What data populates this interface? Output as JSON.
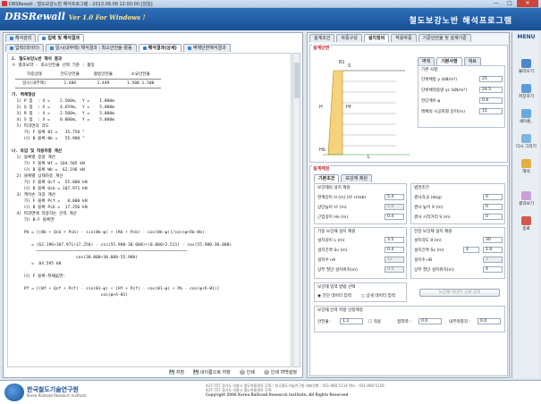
{
  "window": {
    "title": "DBSRewall : 철도보강노반 해석프로그램 - 2013.08.08 12:00:00 [임일]",
    "min": "—",
    "max": "□",
    "close": "✕"
  },
  "header": {
    "logo": "DBSRewall",
    "version": "Ver 1.0 For Windows !",
    "title": "철도보강노반 해석프로그램"
  },
  "left_tabs": [
    "해석관리",
    "입력 및 해석결과"
  ],
  "sub_tabs": [
    "입력(데이터)",
    "일시(내부랙) 해석결과 : 최소안전율-활동",
    "해석결과(상세)",
    "벽체단면해석결과"
  ],
  "doc": {
    "h1": "2. 철도보강노반 해석 결과",
    "summary": "※ 결과요약 - 최소안전율 선택 기준 : 활동",
    "table": {
      "headers": [
        "하중상태",
        "전도안전율",
        "활동안전율",
        "소요안전율"
      ],
      "rows": [
        [
          "일시(내부랙)",
          "1.486",
          "1.449",
          "1.500  1.500"
        ]
      ]
    },
    "lines": [
      "가. 벽체형상",
      "  1) P 점  : X =    2.500m,  Y =    1.800m",
      "  2) Q 점  : X =    4.659m,  Y =    5.000m",
      "  3) R 점  : X =    2.500m,  Y =    5.000m",
      "  4) S 점  : X =    0.000m,  Y =    5.000m",
      "  5) 파괴면의 각도",
      "     가) F 블록 θ1 =   35.750 °",
      "     나) B 블록 θb =   55.980 °",
      "",
      "나. 토압 및 작용하중 계산",
      "  1) 블록별 중량 계산",
      "     가) F 블록 Wf = 104.505 kN",
      "     나) B 블록 Wb =  62.196 kN",
      "  2) 블록별 상재하중 계산",
      "     가) F 블록 Qcf =  55.000 kN",
      "     나) B 블록 Qcb = 107.971 kN",
      "  3) 케이슨 하중 계산",
      "     가) F 블록 Pcf =   0.000 kN",
      "     나) B 블록 Pcb =  17.256 kN",
      "  4) 파괴면에 작용하는 인력 계산",
      "     가) B-F 블록면",
      "",
      "     Pb = [(Wb + Qcb + Pcb) · sin(θb-φ) + (Rb + Pcb) · cos(θb-φ)]/cos(φ+δb-θb)",
      "",
      "        = (62.196+107.971+17.256) · sin(55.980-30.000)+(0.000+2.511) · cos(55.980-30.000)",
      "          ─────────────────────────────────────────────────────────────",
      "                          cos(30.000+30.000-55.980)",
      "        =  84.595 kN",
      "",
      "     나) F 블록-뒤채움면:",
      "",
      "     Pf = [(Wf + Qcf + Pcf) · sin(θ1-φ) + (Hf + Pcf) · cos(θ1-φ) + Pb · cos(φ+δ-θ1)]",
      "                                    cos(φ+δ-θ1)"
    ]
  },
  "bottom_tools": [
    "저장",
    "내이름으로 저장",
    "인쇄",
    "인쇄 여백설정"
  ],
  "right_tabs": [
    "설계조건",
    "자중구성",
    "설치정의",
    "작용하중",
    "기준안전율 및 설계기준"
  ],
  "section": {
    "title": "설계단면",
    "tabs": [
      "벽체",
      "기본사항",
      "재료"
    ],
    "group": "기본 사항",
    "fields": [
      {
        "label": "단위체중 γ (kN/m³)",
        "value": "25"
      },
      {
        "label": "단위체적중량 γc (kN/m³)",
        "value": "24.5"
      },
      {
        "label": "전단계수 φ",
        "value": "0.6"
      },
      {
        "label": "벽체의 시공마찰 길이(m)",
        "value": "15"
      }
    ],
    "dims": [
      "B1",
      "S",
      "H",
      "Hf",
      "Hb",
      "L"
    ]
  },
  "reinf": {
    "title": "설계제원",
    "tabs": [
      "기본조건",
      "보강재 제원"
    ],
    "g1": {
      "title": "보강재의 설치 제원",
      "fields": [
        {
          "label": "연계길이 H (m) (H'+Heb)",
          "value": "5.4"
        },
        {
          "label": "상단높이 H' (m)",
          "value": "5.0"
        },
        {
          "label": "근입깊이 He (m)",
          "value": "0.4"
        }
      ]
    },
    "g2": {
      "title": "법면조건",
      "fields": [
        {
          "label": "경사각 β (deg)",
          "value": "0"
        },
        {
          "label": "경사 높이 X (m)",
          "value": "0"
        },
        {
          "label": "경사 시작거리 S (m)",
          "value": "0"
        }
      ]
    },
    "g3": {
      "title": "기둥 보강재 설치 제원",
      "fields": [
        {
          "label": "설치길이 L (m)",
          "value": "3.5"
        },
        {
          "label": "설치간격 Sv (m)",
          "value": "0.4"
        },
        {
          "label": "설치수 nA",
          "value": "12"
        },
        {
          "label": "상부 첫단 설치위치(m)",
          "value": "0.4"
        }
      ]
    },
    "g4": {
      "title": "전장 보강재 설치 제원",
      "fields": [
        {
          "label": "설치각도 θ (m)",
          "value": "30"
        },
        {
          "label": "설치간격 Sv (m)",
          "value": "4"
        },
        {
          "label": "설치수 nB",
          "value": "3"
        },
        {
          "label": "상부 첫단 설치위치(m)",
          "value": "4"
        }
      ],
      "spin": "1.6"
    },
    "g5": {
      "title": "보강재 입력 방법 선택",
      "options": [
        "간단 데이터 입력",
        "상세 데이터 입력"
      ]
    },
    "btn": "보강재 데이터 상세 입력",
    "g6": {
      "title": "보강재 인력 저항 산정계정",
      "fields": [
        {
          "label": "안전율 :",
          "value": "1.2"
        },
        {
          "label": "접착력 :",
          "value": "0.0"
        },
        {
          "label": "내부마찰각 :",
          "value": "0.0"
        }
      ],
      "check": "적용"
    }
  },
  "menu": {
    "title": "MENU",
    "items": [
      "불러오기",
      "저장하기",
      "새이름..",
      "다시 그리기",
      "해석",
      "결과보기",
      "종료"
    ]
  },
  "footer": {
    "org": "한국철도기술연구원",
    "org_en": "Korea Railroad Research Institute",
    "addr1": "437-757  경기도 의왕시 철도박물관로 176 / 한국철도기술연구원  대표전화 : 031-460-5114  팩스 : 031-460-5159",
    "addr2": "437-757  경기도 의왕시 철도박물관로 176",
    "copy": "Copyright 2006 Korea Railroad Research Institute, All Rights Reserved"
  }
}
